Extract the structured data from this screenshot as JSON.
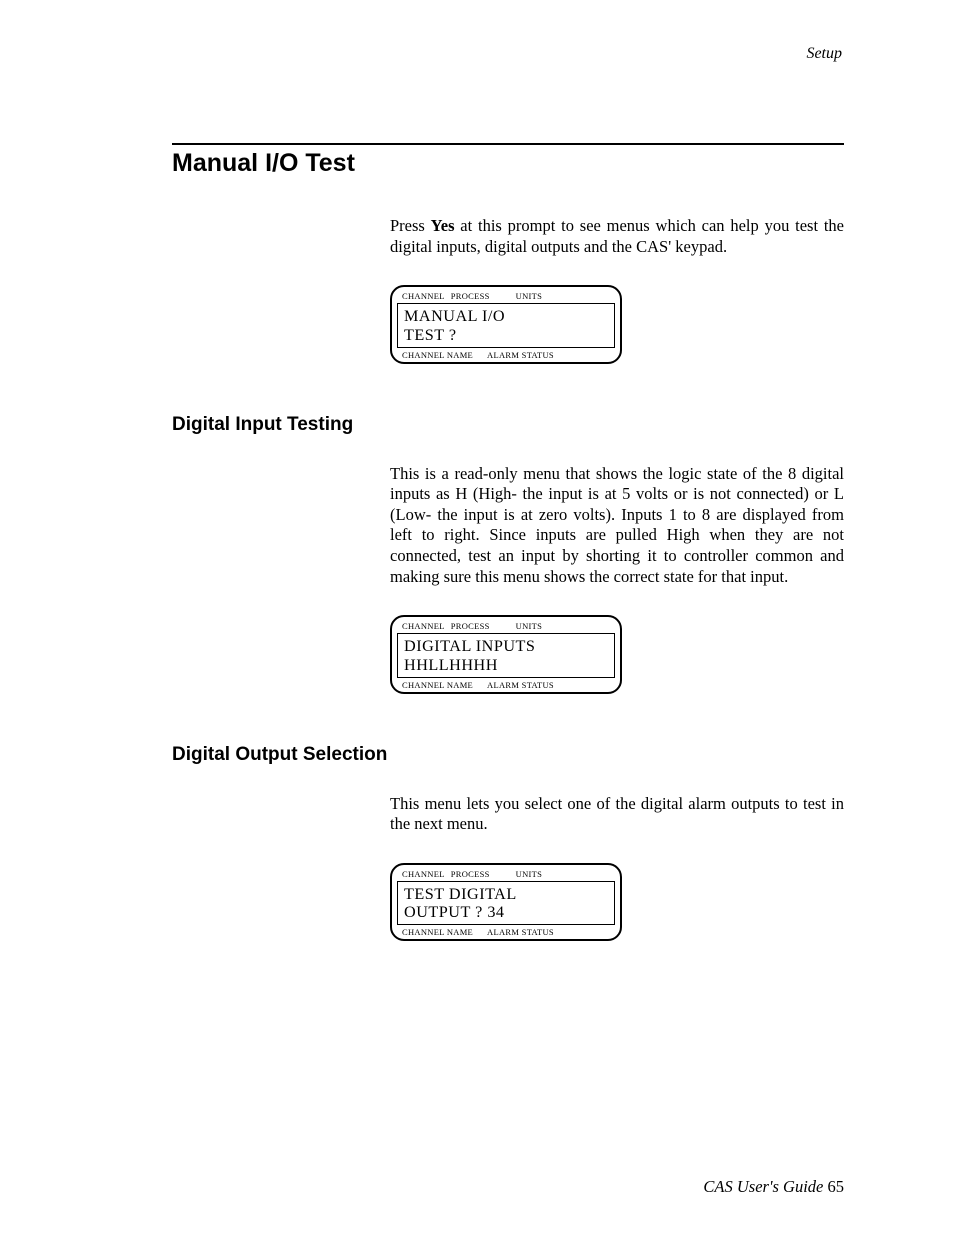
{
  "header": {
    "right": "Setup"
  },
  "section": {
    "title": "Manual I/O Test",
    "intro_pre": "Press ",
    "intro_bold": "Yes",
    "intro_post": " at this prompt to see menus which can help you test the digital inputs, digital outputs and the CAS' keypad."
  },
  "lcd_labels": {
    "top_channel": "CHANNEL",
    "top_process": "PROCESS",
    "top_units": "UNITS",
    "bot_name": "CHANNEL NAME",
    "bot_alarm": "ALARM STATUS"
  },
  "lcd1": {
    "line1": "MANUAL  I/O",
    "line2": "TEST  ?"
  },
  "sub1": {
    "title": "Digital Input Testing",
    "para": "This is a read-only menu that shows the logic state of the 8 digital inputs as H (High- the input is at 5 volts or is not connected) or L (Low- the input is at zero volts). Inputs 1 to 8 are displayed from left to right. Since inputs are pulled High when they are not connected, test an input by shorting it to controller common and making sure this menu shows the correct state for that input."
  },
  "lcd2": {
    "line1": "DIGITAL  INPUTS",
    "line2": "HHLLHHHH"
  },
  "sub2": {
    "title": "Digital Output Selection",
    "para": "This menu lets you select one of the digital alarm outputs to test in the next menu."
  },
  "lcd3": {
    "line1": "TEST  DIGITAL",
    "line2": "OUTPUT ?  34"
  },
  "footer": {
    "text": "CAS User's Guide ",
    "page": "65"
  }
}
